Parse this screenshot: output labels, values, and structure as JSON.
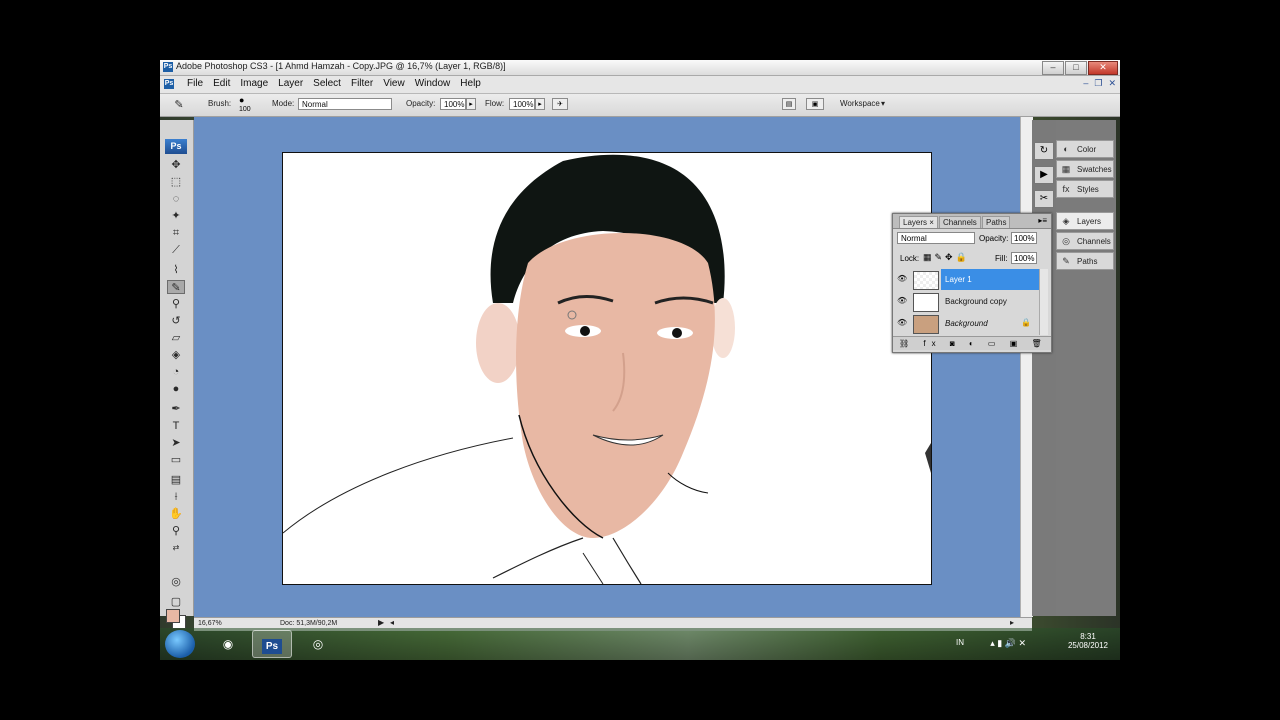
{
  "window": {
    "title": "Adobe Photoshop CS3 - [1 Ahmd Hamzah - Copy.JPG @ 16,7% (Layer 1, RGB/8)]",
    "app_badge": "Ps"
  },
  "menu": [
    "File",
    "Edit",
    "Image",
    "Layer",
    "Select",
    "Filter",
    "View",
    "Window",
    "Help"
  ],
  "options_bar": {
    "brush_label": "Brush:",
    "brush_size": "100",
    "mode_label": "Mode:",
    "mode_value": "Normal",
    "opacity_label": "Opacity:",
    "opacity_value": "100%",
    "flow_label": "Flow:",
    "flow_value": "100%",
    "workspace_label": "Workspace"
  },
  "toolbox": {
    "logo": "Ps"
  },
  "panels_dock": [
    {
      "label": "Color",
      "icon": "color-icon"
    },
    {
      "label": "Swatches",
      "icon": "swatches-icon"
    },
    {
      "label": "Styles",
      "icon": "styles-icon"
    },
    {
      "label": "Layers",
      "icon": "layers-icon"
    },
    {
      "label": "Channels",
      "icon": "channels-icon"
    },
    {
      "label": "Paths",
      "icon": "paths-icon"
    }
  ],
  "layers_panel": {
    "tabs": [
      "Layers",
      "Channels",
      "Paths"
    ],
    "blend_mode": "Normal",
    "opacity_label": "Opacity:",
    "opacity_value": "100%",
    "lock_label": "Lock:",
    "fill_label": "Fill:",
    "fill_value": "100%",
    "layers": [
      {
        "name": "Layer 1",
        "selected": true
      },
      {
        "name": "Background copy",
        "selected": false
      },
      {
        "name": "Background",
        "selected": false,
        "locked": true
      }
    ]
  },
  "status": {
    "zoom": "16,67%",
    "doc": "Doc: 51,3M/90,2M"
  },
  "taskbar": {
    "lang": "IN",
    "time": "8:31",
    "date": "25/08/2012"
  },
  "colors": {
    "foreground": "#e8b8a4",
    "background": "#ffffff",
    "workspace": "#6a8fc4",
    "selection": "#3a8ee6"
  }
}
